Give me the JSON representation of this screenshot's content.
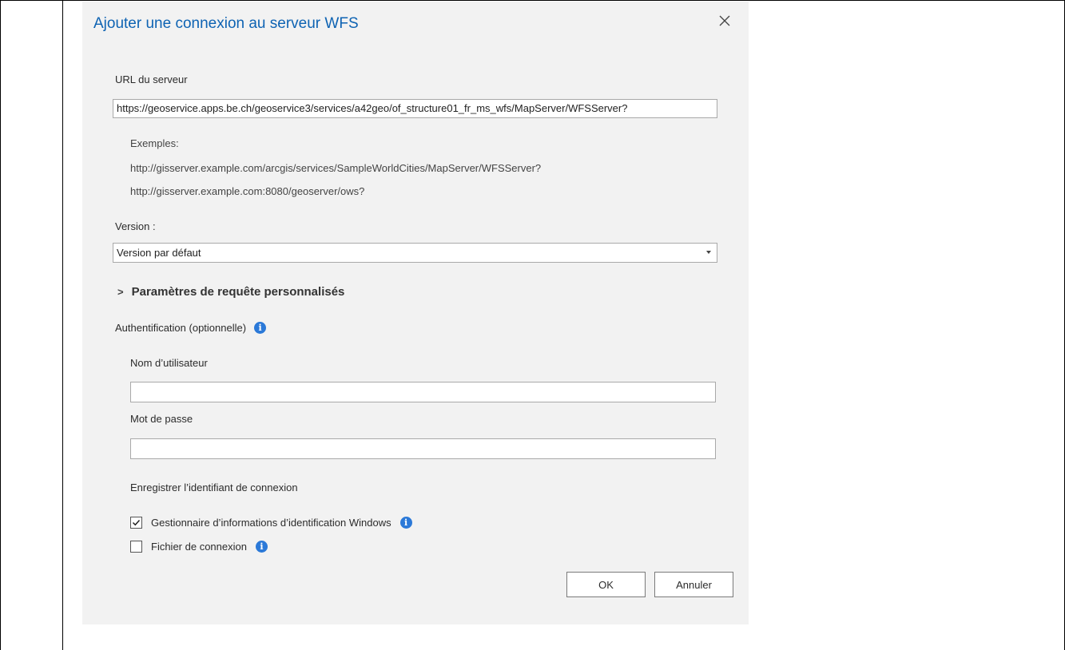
{
  "dialog": {
    "title": "Ajouter une connexion au serveur WFS",
    "close_icon": "close-icon"
  },
  "server": {
    "url_label": "URL du serveur",
    "url_value": "https://geoservice.apps.be.ch/geoservice3/services/a42geo/of_structure01_fr_ms_wfs/MapServer/WFSServer?",
    "examples_label": "Exemples:",
    "example_1": "http://gisserver.example.com/arcgis/services/SampleWorldCities/MapServer/WFSServer?",
    "example_2": "http://gisserver.example.com:8080/geoserver/ows?"
  },
  "version": {
    "label": "Version :",
    "selected": "Version par défaut"
  },
  "custom_params": {
    "label": "Paramètres de requête personnalisés",
    "icon": "chevron-right-icon"
  },
  "auth": {
    "label": "Authentification (optionnelle)",
    "username_label": "Nom d’utilisateur",
    "username_value": "",
    "password_label": "Mot de passe",
    "password_value": "",
    "save_label": "Enregistrer l’identifiant de connexion",
    "options": [
      {
        "label": "Gestionnaire d’informations d’identification Windows",
        "checked": true
      },
      {
        "label": "Fichier de connexion",
        "checked": false
      }
    ]
  },
  "buttons": {
    "ok": "OK",
    "cancel": "Annuler"
  },
  "colors": {
    "accent": "#0e63b3",
    "info": "#2b79d8",
    "dialog_bg": "#f2f2f2"
  }
}
